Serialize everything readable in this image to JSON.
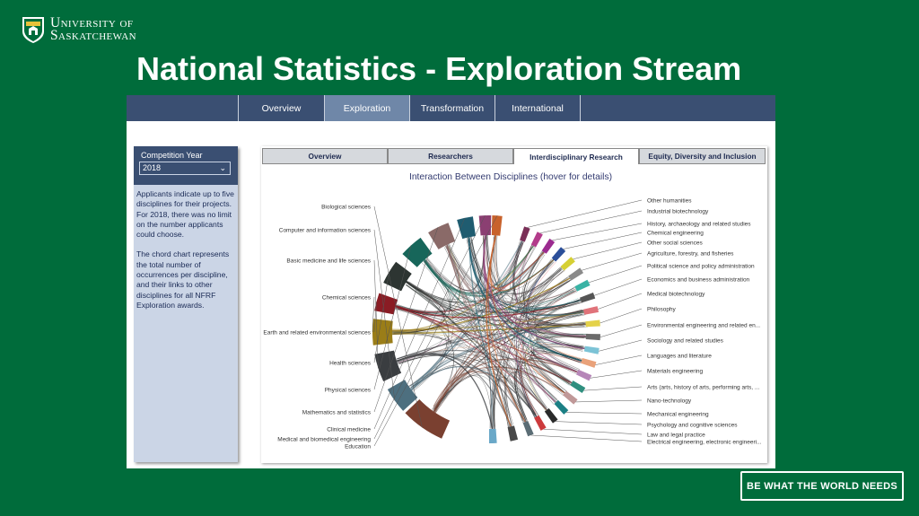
{
  "branding": {
    "university_line1": "University of",
    "university_line2": "Saskatchewan",
    "tagline": "BE WHAT THE WORLD NEEDS"
  },
  "slide_title": "National Statistics - Exploration Stream",
  "top_tabs": [
    {
      "label": "Overview",
      "active": false
    },
    {
      "label": "Exploration",
      "active": true
    },
    {
      "label": "Transformation",
      "active": false
    },
    {
      "label": "International",
      "active": false
    }
  ],
  "filter": {
    "label": "Competition Year",
    "value": "2018"
  },
  "description": {
    "p1": "Applicants indicate up to five disciplines for their projects. For 2018, there was no limit on the number applicants could choose.",
    "p2": "The chord chart represents the total number of occurrences per discipline, and their links to other disciplines for all NFRF Exploration awards."
  },
  "sub_tabs": [
    {
      "label": "Overview",
      "active": false
    },
    {
      "label": "Researchers",
      "active": false
    },
    {
      "label": "Interdisciplinary Research",
      "active": true
    },
    {
      "label": "Equity, Diversity and Inclusion",
      "active": false
    }
  ],
  "chart_title": "Interaction Between Disciplines (hover for details)",
  "chart_data": {
    "type": "chord",
    "left_disciplines": [
      {
        "name": "Biological sciences",
        "color": "#7a4030"
      },
      {
        "name": "Computer and information sciences",
        "color": "#4d6f7f"
      },
      {
        "name": "Basic medicine and life sciences",
        "color": "#3a3d40"
      },
      {
        "name": "Chemical sciences",
        "color": "#9a7d18"
      },
      {
        "name": "Earth and related environmental sciences",
        "color": "#8a1c24"
      },
      {
        "name": "Health sciences",
        "color": "#2d3532"
      },
      {
        "name": "Physical sciences",
        "color": "#17665a"
      },
      {
        "name": "Mathematics and statistics",
        "color": "#8a6a68"
      },
      {
        "name": "Clinical medicine",
        "color": "#1f5c70"
      },
      {
        "name": "Medical and biomedical engineering",
        "color": "#8b3f72"
      },
      {
        "name": "Education",
        "color": "#c8622c"
      }
    ],
    "right_disciplines": [
      {
        "name": "Other humanities",
        "color": "#7a2f57"
      },
      {
        "name": "Industrial biotechnology",
        "color": "#b23b8a"
      },
      {
        "name": "History, archaeology and related studies",
        "color": "#9b2b8f"
      },
      {
        "name": "Chemical engineering",
        "color": "#2b4f9a"
      },
      {
        "name": "Other social sciences",
        "color": "#d6d034"
      },
      {
        "name": "Agriculture, forestry, and fisheries",
        "color": "#8a8a8a"
      },
      {
        "name": "Political science and policy administration",
        "color": "#3ab3a5"
      },
      {
        "name": "Economics and business administration",
        "color": "#555555"
      },
      {
        "name": "Medical biotechnology",
        "color": "#e0737a"
      },
      {
        "name": "Philosophy",
        "color": "#e4d24a"
      },
      {
        "name": "Environmental engineering and related en...",
        "color": "#6b6b6b"
      },
      {
        "name": "Sociology and related studies",
        "color": "#7cc3d6"
      },
      {
        "name": "Languages and literature",
        "color": "#e9a27a"
      },
      {
        "name": "Materials engineering",
        "color": "#b686b8"
      },
      {
        "name": "Arts (arts, history of arts, performing arts, ...",
        "color": "#2f8f7f"
      },
      {
        "name": "Nano-technology",
        "color": "#c09898"
      },
      {
        "name": "Mechanical engineering",
        "color": "#1b7f84"
      },
      {
        "name": "Psychology and cognitive sciences",
        "color": "#2a2a2a"
      },
      {
        "name": "Law and legal practice",
        "color": "#cc3a3c"
      },
      {
        "name": "Electrical engineering, electronic engineeri...",
        "color": "#5b6d75"
      }
    ],
    "bottom_arcs": [
      {
        "color": "#6aa8c8"
      },
      {
        "color": "#484848"
      }
    ]
  }
}
